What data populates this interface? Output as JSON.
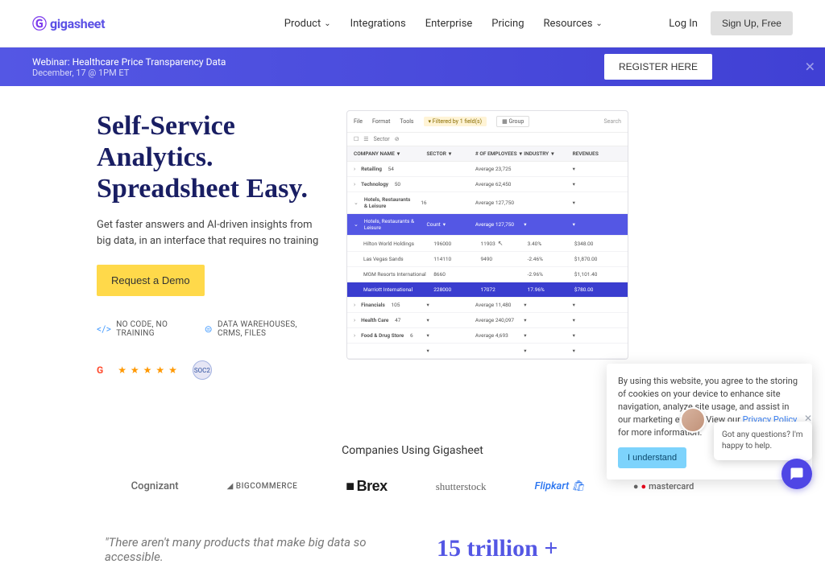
{
  "brand": {
    "name": "gigasheet"
  },
  "nav": {
    "items": [
      {
        "label": "Product",
        "dropdown": true
      },
      {
        "label": "Integrations",
        "dropdown": false
      },
      {
        "label": "Enterprise",
        "dropdown": false
      },
      {
        "label": "Pricing",
        "dropdown": false
      },
      {
        "label": "Resources",
        "dropdown": true
      }
    ],
    "login": "Log In",
    "signup": "Sign Up, Free"
  },
  "banner": {
    "title": "Webinar: Healthcare Price Transparency Data",
    "subtitle": "December, 17 @ 1PM ET",
    "cta": "REGISTER HERE"
  },
  "hero": {
    "title": "Self-Service Analytics. Spreadsheet Easy.",
    "subtitle": "Get faster answers and AI-driven insights from big data, in an interface that requires no training",
    "cta": "Request a Demo",
    "features": [
      "NO CODE, NO TRAINING",
      "DATA WAREHOUSES, CRMS, FILES"
    ],
    "soc_badge": "SOC2"
  },
  "appshot": {
    "toolbar": [
      "File",
      "Format",
      "Tools"
    ],
    "filter": "Filtered by 1 field(s)",
    "group": "Group",
    "search": "Search",
    "sector_label": "Sector",
    "columns": [
      "COMPANY NAME",
      "SECTOR",
      "# OF EMPLOYEES",
      "INDUSTRY",
      "REVENUES"
    ],
    "rows": [
      {
        "name": "Retailing",
        "count": "54",
        "avg": "Average 23,725"
      },
      {
        "name": "Technology",
        "count": "50",
        "avg": "Average 62,450"
      },
      {
        "name": "Hotels, Restaurants & Leisure",
        "count": "16",
        "avg": "Average 127,750"
      }
    ],
    "expanded_header": {
      "name": "Hotels, Restaurants & Leisure",
      "sector": "Count",
      "emp": "Average 127,750"
    },
    "expanded": [
      {
        "name": "Hilton World Holdings",
        "sector": "196000",
        "emp": "11903",
        "ind": "3.40%",
        "rev": "$348.00"
      },
      {
        "name": "Las Vegas Sands",
        "sector": "114110",
        "emp": "9490",
        "ind": "-2.46%",
        "rev": "$1,870.00"
      },
      {
        "name": "MGM Resorts International",
        "sector": "8660",
        "emp": "",
        "ind": "-2.96%",
        "rev": "$1,101.40"
      }
    ],
    "hl_row": {
      "name": "Marriott International",
      "sector": "228000",
      "emp": "17072",
      "ind": "17.96%",
      "rev": "$780.00"
    },
    "rows_after": [
      {
        "name": "Financials",
        "count": "105",
        "avg": "Average 11,480"
      },
      {
        "name": "Health Care",
        "count": "47",
        "avg": "Average 240,097"
      },
      {
        "name": "Food & Drug Store",
        "count": "6",
        "avg": "Average 4,693"
      }
    ]
  },
  "companies": {
    "title": "Companies Using Gigasheet",
    "logos": [
      "Cognizant",
      "BIGCOMMERCE",
      "Brex",
      "shutterstock",
      "Flipkart",
      "mastercard"
    ]
  },
  "stats": {
    "quote": "\"There aren't many products that make big data so accessible.",
    "big": "15 trillion +"
  },
  "cookie": {
    "text_prefix": "By using this website, you agree to the storing of cookies on your device to enhance site navigation, analyze site usage, and assist in our marketing efforts. View our ",
    "link": "Privacy Policy",
    "text_suffix": " for more information.",
    "button": "I understand"
  },
  "chat": {
    "text": "Got any questions? I'm happy to help."
  }
}
